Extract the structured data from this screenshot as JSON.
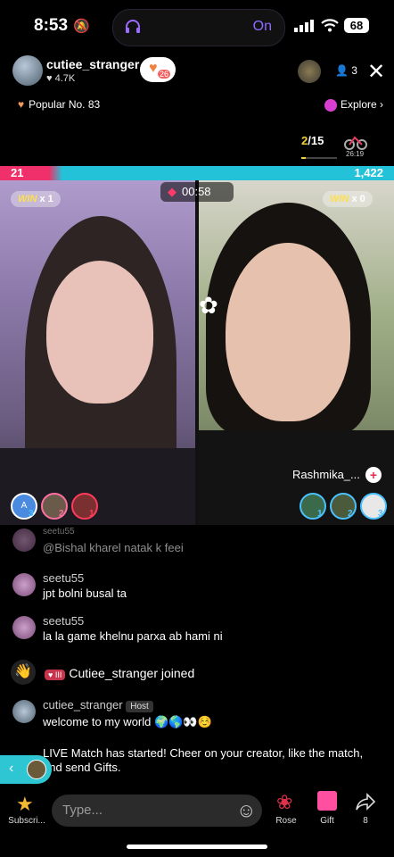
{
  "status": {
    "time": "8:53",
    "island_label": "On",
    "battery": "68"
  },
  "host": {
    "name": "cutiee_stranger",
    "likes": "4.7K",
    "follow_badge": "26",
    "viewer_count": "3"
  },
  "popular": "Popular No. 83",
  "explore": "Explore",
  "rank": {
    "current": "2",
    "total": "/15",
    "progress": 0.13
  },
  "bike_timer": "26:19",
  "score": {
    "left": "21",
    "right": "1,422"
  },
  "match": {
    "timer": "00:58",
    "left_win": "WIN",
    "left_win_count": "x 1",
    "right_win": "WIN",
    "right_win_count": "x 0",
    "right_name": "Rashmika_...",
    "left_supporters": [
      {
        "rank": "3",
        "initial": "A"
      },
      {
        "rank": "2"
      },
      {
        "rank": "1"
      }
    ],
    "right_supporters": [
      {
        "rank": "1"
      },
      {
        "rank": "2"
      },
      {
        "rank": "3"
      }
    ]
  },
  "chat": [
    {
      "user": "seetu55",
      "text": "@Bishal kharel natak k feei",
      "faded": true
    },
    {
      "user": "seetu55",
      "text": "jpt bolni busal ta"
    },
    {
      "user": "seetu55",
      "text": "la la game khelnu parxa ab hami ni"
    },
    {
      "join_level": "III",
      "join_text": "Cutiee_stranger joined"
    },
    {
      "user": "cutiee_stranger",
      "badge": "Host",
      "text": "welcome to my world 🌍🌎👀☺️"
    },
    {
      "text": "LIVE Match has started! Cheer on your creator, like the match, and send Gifts."
    }
  ],
  "bottom": {
    "subscribe": "Subscri...",
    "placeholder": "Type...",
    "rose": "Rose",
    "gift": "Gift",
    "share_count": "8"
  }
}
